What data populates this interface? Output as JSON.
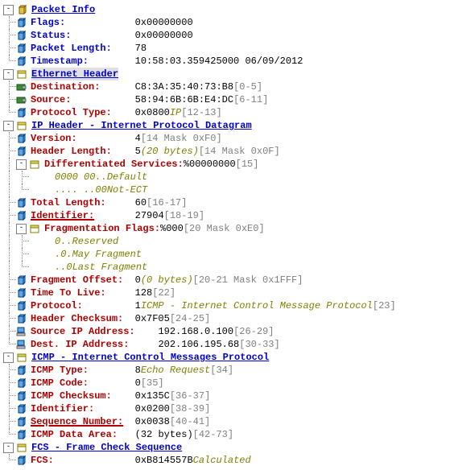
{
  "packetInfo": {
    "title": "Packet Info",
    "flags": {
      "label": "Flags:",
      "value": "0x00000000"
    },
    "status": {
      "label": "Status:",
      "value": "0x00000000"
    },
    "length": {
      "label": "Packet Length:",
      "value": "78"
    },
    "time": {
      "label": "Timestamp:",
      "value": "10:58:03.359425000 06/09/2012"
    }
  },
  "eth": {
    "title": "Ethernet Header",
    "dest": {
      "label": "Destination:",
      "value": "C8:3A:35:40:73:B8",
      "anno": "[0-5]"
    },
    "src": {
      "label": "Source:",
      "value": "58:94:6B:6B:E4:DC",
      "anno": "[6-11]"
    },
    "proto": {
      "label": "Protocol Type:",
      "value": "0x0800",
      "extra": "IP",
      "anno": "[12-13]"
    }
  },
  "ip": {
    "title": "IP Header - Internet Protocol Datagram",
    "version": {
      "label": "Version:",
      "value": "4",
      "anno": "[14 Mask 0xF0]"
    },
    "hlen": {
      "label": "Header Length:",
      "value": "5",
      "extra": "(20 bytes)",
      "anno": "[14 Mask 0x0F]"
    },
    "diff": {
      "label": "Differentiated Services:",
      "value": "%00000000",
      "anno": "[15]",
      "bits1": {
        "pattern": "0000 00..",
        "meaning": "Default"
      },
      "bits2": {
        "pattern": ".... ..00",
        "meaning": "Not-ECT"
      }
    },
    "totlen": {
      "label": "Total Length:",
      "value": "60",
      "anno": "[16-17]"
    },
    "ident": {
      "label": "Identifier:",
      "value": "27904",
      "anno": "[18-19]"
    },
    "frag": {
      "label": "Fragmentation Flags:",
      "value": "%000",
      "anno": "[20 Mask 0xE0]",
      "b1": {
        "pattern": "0..",
        "meaning": "Reserved"
      },
      "b2": {
        "pattern": ".0.",
        "meaning": "May Fragment"
      },
      "b3": {
        "pattern": "..0",
        "meaning": "Last Fragment"
      }
    },
    "fragoff": {
      "label": "Fragment Offset:",
      "value": "0",
      "extra": "(0 bytes)",
      "anno": "[20-21 Mask 0x1FFF]"
    },
    "ttl": {
      "label": "Time To Live:",
      "value": "128",
      "anno": "[22]"
    },
    "proto": {
      "label": "Protocol:",
      "value": "1",
      "extra": "ICMP - Internet Control Message Protocol",
      "anno": "[23]"
    },
    "chksum": {
      "label": "Header Checksum:",
      "value": "0x7F05",
      "anno": "[24-25]"
    },
    "srcip": {
      "label": "Source IP Address:",
      "value": "192.168.0.100",
      "anno": "[26-29]"
    },
    "dstip": {
      "label": "Dest. IP Address:",
      "value": "202.106.195.68",
      "anno": "[30-33]"
    }
  },
  "icmp": {
    "title": "ICMP - Internet Control Messages Protocol",
    "type": {
      "label": "ICMP Type:",
      "value": "8",
      "extra": "Echo Request",
      "anno": "[34]"
    },
    "code": {
      "label": "ICMP Code:",
      "value": "0",
      "anno": "[35]"
    },
    "chksum": {
      "label": "ICMP Checksum:",
      "value": "0x135C",
      "anno": "[36-37]"
    },
    "ident": {
      "label": "Identifier:",
      "value": "0x0200",
      "anno": "[38-39]"
    },
    "seq": {
      "label": "Sequence Number:",
      "value": "0x0038",
      "anno": "[40-41]"
    },
    "data": {
      "label": "ICMP Data Area:",
      "value": "(32 bytes)",
      "anno": "[42-73]"
    }
  },
  "fcs": {
    "title": "FCS - Frame Check Sequence",
    "fcs": {
      "label": "FCS:",
      "value": "0xB814557B",
      "extra": "Calculated"
    }
  }
}
